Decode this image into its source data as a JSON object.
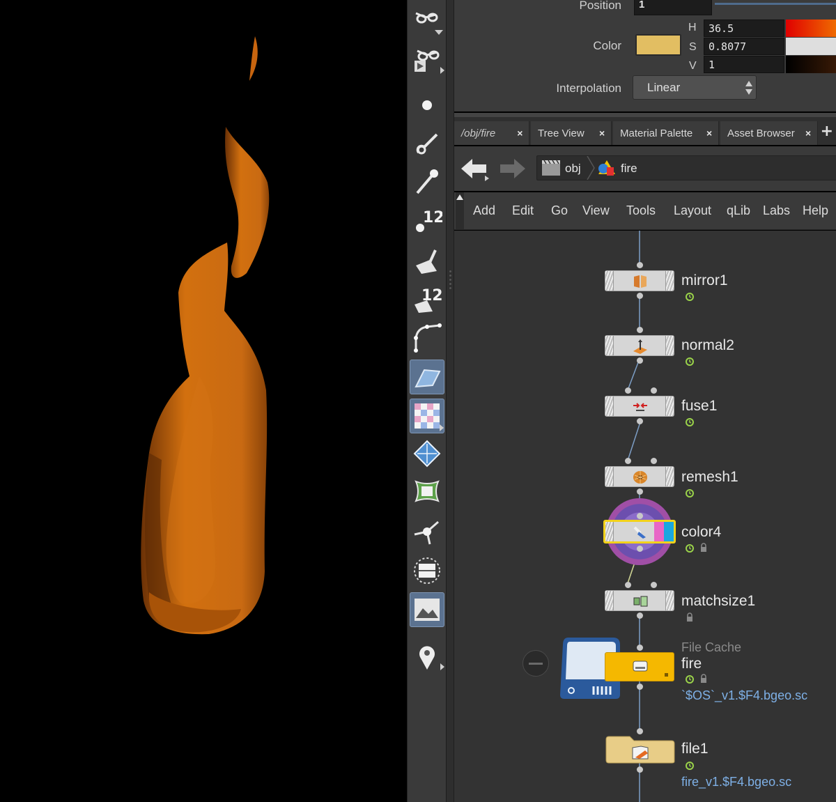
{
  "params": {
    "position_label": "Position",
    "position_value": "1",
    "color_label": "Color",
    "color_hex": "#e2be62",
    "h_label": "H",
    "h_value": "36.5",
    "s_label": "S",
    "s_value": "0.8077",
    "v_label": "V",
    "v_value": "1",
    "interp_label": "Interpolation",
    "interp_value": "Linear"
  },
  "tabs": [
    {
      "label": "/obj/fire"
    },
    {
      "label": "Tree View"
    },
    {
      "label": "Material Palette"
    },
    {
      "label": "Asset Browser"
    }
  ],
  "tab_close_glyph": "×",
  "tab_add_glyph": "+",
  "path": {
    "crumb1": "obj",
    "crumb2": "fire"
  },
  "menu": [
    "Add",
    "Edit",
    "Go",
    "View",
    "Tools",
    "Layout",
    "qLib",
    "Labs",
    "Help"
  ],
  "shelf_tools": [
    "view-glasses-icon",
    "view-play-glasses-icon",
    "point-icon",
    "brush-icon",
    "pen-icon",
    "point-number-icon",
    "primitive-icon",
    "primitive-number-icon",
    "curve-icon",
    "shaded-plane-icon",
    "checker-uv-icon",
    "diamond-icon",
    "uv-unwrap-icon",
    "joint-icon",
    "safe-area-icon",
    "background-image-icon",
    "location-pin-icon"
  ],
  "nodes": [
    {
      "name": "mirror1",
      "icon": "mirror-icon"
    },
    {
      "name": "normal2",
      "icon": "normal-icon"
    },
    {
      "name": "fuse1",
      "icon": "fuse-icon"
    },
    {
      "name": "remesh1",
      "icon": "remesh-icon"
    },
    {
      "name": "color4",
      "icon": "color-icon",
      "selected": true
    },
    {
      "name": "matchsize1",
      "icon": "matchsize-icon"
    },
    {
      "name": "fire",
      "type": "File Cache",
      "parm": "`$OS`_v1.$F4.bgeo.sc",
      "icon": "file-cache-icon",
      "color": "#f5b800"
    },
    {
      "name": "file1",
      "parm": "fire_v1.$F4.bgeo.sc",
      "icon": "file-icon",
      "color": "#e8cd87"
    }
  ],
  "colors": {
    "fire_shape": "#c96a12",
    "node_default": "#d6d6d6",
    "node_selected_outline": "#f2d21b",
    "file_cache_node": "#f5b800",
    "file_node": "#e8cd87",
    "parm_text": "#7eb0e6"
  }
}
